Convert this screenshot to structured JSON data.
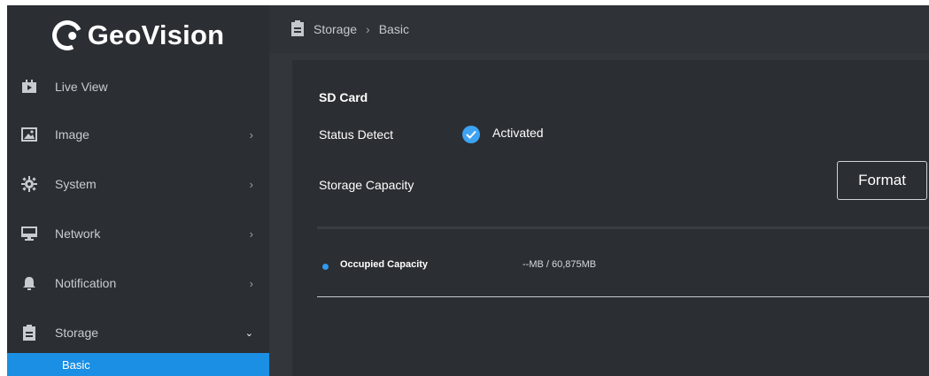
{
  "brand": {
    "name": "GeoVision"
  },
  "sidebar": {
    "items": [
      {
        "label": "Live View",
        "icon": "video-icon",
        "has_chevron": false
      },
      {
        "label": "Image",
        "icon": "image-icon",
        "has_chevron": true
      },
      {
        "label": "System",
        "icon": "gear-icon",
        "has_chevron": true
      },
      {
        "label": "Network",
        "icon": "monitor-icon",
        "has_chevron": true
      },
      {
        "label": "Notification",
        "icon": "bell-icon",
        "has_chevron": true
      },
      {
        "label": "Storage",
        "icon": "clipboard-icon",
        "has_chevron": true,
        "expanded": true
      }
    ],
    "sub_items": [
      {
        "label": "Basic",
        "selected": true
      }
    ]
  },
  "breadcrumb": {
    "section": "Storage",
    "separator": "›",
    "page": "Basic"
  },
  "panel": {
    "title": "SD Card",
    "status_label": "Status Detect",
    "status_value": "Activated",
    "capacity_label": "Storage Capacity",
    "format_button": "Format",
    "occupied_label": "Occupied Capacity",
    "occupied_value": "--MB / 60,875MB"
  },
  "colors": {
    "accent": "#1a8fe3",
    "background": "#2a2d31"
  }
}
